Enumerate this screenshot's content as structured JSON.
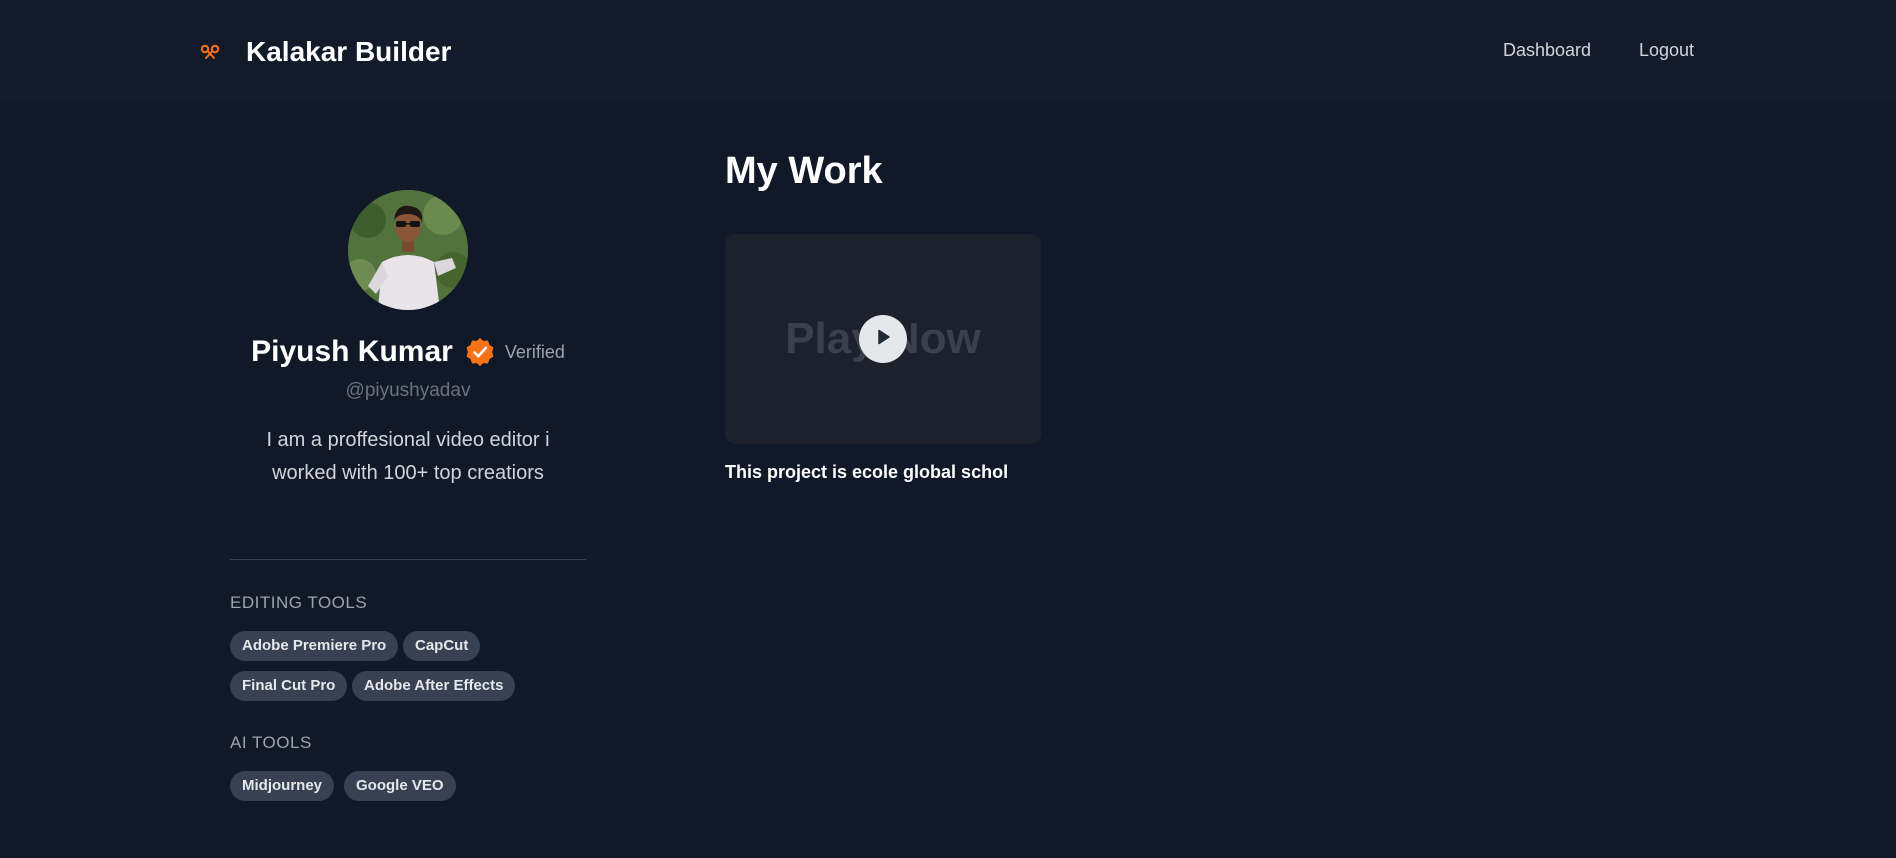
{
  "header": {
    "brand": "Kalakar Builder",
    "brand_icon": "ribbon-icon",
    "nav": [
      "Dashboard",
      "Logout"
    ]
  },
  "profile": {
    "name": "Piyush Kumar",
    "verified_label": "Verified",
    "handle": "@piyushyadav",
    "bio": "I am a proffesional video editor i worked with 100+ top creatiors",
    "accent_color": "#f97316",
    "sections": [
      {
        "title": "EDITING TOOLS",
        "tools": [
          "Adobe Premiere Pro",
          "CapCut",
          "Final Cut Pro",
          "Adobe After Effects"
        ]
      },
      {
        "title": "AI TOOLS",
        "tools": [
          "Midjourney",
          "Google VEO"
        ]
      }
    ]
  },
  "work": {
    "title": "My Work",
    "items": [
      {
        "thumbnail_text": "Play Now",
        "caption": "This project is ecole global schol",
        "icon": "play-icon"
      }
    ]
  }
}
